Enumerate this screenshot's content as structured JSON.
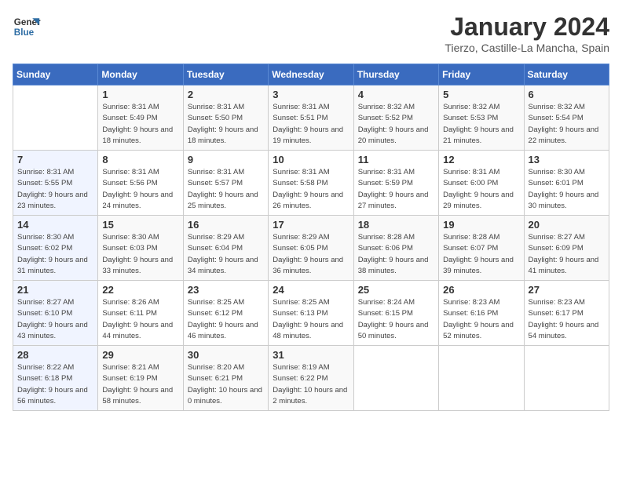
{
  "logo": {
    "line1": "General",
    "line2": "Blue"
  },
  "title": "January 2024",
  "subtitle": "Tierzo, Castille-La Mancha, Spain",
  "days_of_week": [
    "Sunday",
    "Monday",
    "Tuesday",
    "Wednesday",
    "Thursday",
    "Friday",
    "Saturday"
  ],
  "weeks": [
    [
      {
        "day": "",
        "sunrise": "",
        "sunset": "",
        "daylight": ""
      },
      {
        "day": "1",
        "sunrise": "Sunrise: 8:31 AM",
        "sunset": "Sunset: 5:49 PM",
        "daylight": "Daylight: 9 hours and 18 minutes."
      },
      {
        "day": "2",
        "sunrise": "Sunrise: 8:31 AM",
        "sunset": "Sunset: 5:50 PM",
        "daylight": "Daylight: 9 hours and 18 minutes."
      },
      {
        "day": "3",
        "sunrise": "Sunrise: 8:31 AM",
        "sunset": "Sunset: 5:51 PM",
        "daylight": "Daylight: 9 hours and 19 minutes."
      },
      {
        "day": "4",
        "sunrise": "Sunrise: 8:32 AM",
        "sunset": "Sunset: 5:52 PM",
        "daylight": "Daylight: 9 hours and 20 minutes."
      },
      {
        "day": "5",
        "sunrise": "Sunrise: 8:32 AM",
        "sunset": "Sunset: 5:53 PM",
        "daylight": "Daylight: 9 hours and 21 minutes."
      },
      {
        "day": "6",
        "sunrise": "Sunrise: 8:32 AM",
        "sunset": "Sunset: 5:54 PM",
        "daylight": "Daylight: 9 hours and 22 minutes."
      }
    ],
    [
      {
        "day": "7",
        "sunrise": "Sunrise: 8:31 AM",
        "sunset": "Sunset: 5:55 PM",
        "daylight": "Daylight: 9 hours and 23 minutes."
      },
      {
        "day": "8",
        "sunrise": "Sunrise: 8:31 AM",
        "sunset": "Sunset: 5:56 PM",
        "daylight": "Daylight: 9 hours and 24 minutes."
      },
      {
        "day": "9",
        "sunrise": "Sunrise: 8:31 AM",
        "sunset": "Sunset: 5:57 PM",
        "daylight": "Daylight: 9 hours and 25 minutes."
      },
      {
        "day": "10",
        "sunrise": "Sunrise: 8:31 AM",
        "sunset": "Sunset: 5:58 PM",
        "daylight": "Daylight: 9 hours and 26 minutes."
      },
      {
        "day": "11",
        "sunrise": "Sunrise: 8:31 AM",
        "sunset": "Sunset: 5:59 PM",
        "daylight": "Daylight: 9 hours and 27 minutes."
      },
      {
        "day": "12",
        "sunrise": "Sunrise: 8:31 AM",
        "sunset": "Sunset: 6:00 PM",
        "daylight": "Daylight: 9 hours and 29 minutes."
      },
      {
        "day": "13",
        "sunrise": "Sunrise: 8:30 AM",
        "sunset": "Sunset: 6:01 PM",
        "daylight": "Daylight: 9 hours and 30 minutes."
      }
    ],
    [
      {
        "day": "14",
        "sunrise": "Sunrise: 8:30 AM",
        "sunset": "Sunset: 6:02 PM",
        "daylight": "Daylight: 9 hours and 31 minutes."
      },
      {
        "day": "15",
        "sunrise": "Sunrise: 8:30 AM",
        "sunset": "Sunset: 6:03 PM",
        "daylight": "Daylight: 9 hours and 33 minutes."
      },
      {
        "day": "16",
        "sunrise": "Sunrise: 8:29 AM",
        "sunset": "Sunset: 6:04 PM",
        "daylight": "Daylight: 9 hours and 34 minutes."
      },
      {
        "day": "17",
        "sunrise": "Sunrise: 8:29 AM",
        "sunset": "Sunset: 6:05 PM",
        "daylight": "Daylight: 9 hours and 36 minutes."
      },
      {
        "day": "18",
        "sunrise": "Sunrise: 8:28 AM",
        "sunset": "Sunset: 6:06 PM",
        "daylight": "Daylight: 9 hours and 38 minutes."
      },
      {
        "day": "19",
        "sunrise": "Sunrise: 8:28 AM",
        "sunset": "Sunset: 6:07 PM",
        "daylight": "Daylight: 9 hours and 39 minutes."
      },
      {
        "day": "20",
        "sunrise": "Sunrise: 8:27 AM",
        "sunset": "Sunset: 6:09 PM",
        "daylight": "Daylight: 9 hours and 41 minutes."
      }
    ],
    [
      {
        "day": "21",
        "sunrise": "Sunrise: 8:27 AM",
        "sunset": "Sunset: 6:10 PM",
        "daylight": "Daylight: 9 hours and 43 minutes."
      },
      {
        "day": "22",
        "sunrise": "Sunrise: 8:26 AM",
        "sunset": "Sunset: 6:11 PM",
        "daylight": "Daylight: 9 hours and 44 minutes."
      },
      {
        "day": "23",
        "sunrise": "Sunrise: 8:25 AM",
        "sunset": "Sunset: 6:12 PM",
        "daylight": "Daylight: 9 hours and 46 minutes."
      },
      {
        "day": "24",
        "sunrise": "Sunrise: 8:25 AM",
        "sunset": "Sunset: 6:13 PM",
        "daylight": "Daylight: 9 hours and 48 minutes."
      },
      {
        "day": "25",
        "sunrise": "Sunrise: 8:24 AM",
        "sunset": "Sunset: 6:15 PM",
        "daylight": "Daylight: 9 hours and 50 minutes."
      },
      {
        "day": "26",
        "sunrise": "Sunrise: 8:23 AM",
        "sunset": "Sunset: 6:16 PM",
        "daylight": "Daylight: 9 hours and 52 minutes."
      },
      {
        "day": "27",
        "sunrise": "Sunrise: 8:23 AM",
        "sunset": "Sunset: 6:17 PM",
        "daylight": "Daylight: 9 hours and 54 minutes."
      }
    ],
    [
      {
        "day": "28",
        "sunrise": "Sunrise: 8:22 AM",
        "sunset": "Sunset: 6:18 PM",
        "daylight": "Daylight: 9 hours and 56 minutes."
      },
      {
        "day": "29",
        "sunrise": "Sunrise: 8:21 AM",
        "sunset": "Sunset: 6:19 PM",
        "daylight": "Daylight: 9 hours and 58 minutes."
      },
      {
        "day": "30",
        "sunrise": "Sunrise: 8:20 AM",
        "sunset": "Sunset: 6:21 PM",
        "daylight": "Daylight: 10 hours and 0 minutes."
      },
      {
        "day": "31",
        "sunrise": "Sunrise: 8:19 AM",
        "sunset": "Sunset: 6:22 PM",
        "daylight": "Daylight: 10 hours and 2 minutes."
      },
      {
        "day": "",
        "sunrise": "",
        "sunset": "",
        "daylight": ""
      },
      {
        "day": "",
        "sunrise": "",
        "sunset": "",
        "daylight": ""
      },
      {
        "day": "",
        "sunrise": "",
        "sunset": "",
        "daylight": ""
      }
    ]
  ]
}
